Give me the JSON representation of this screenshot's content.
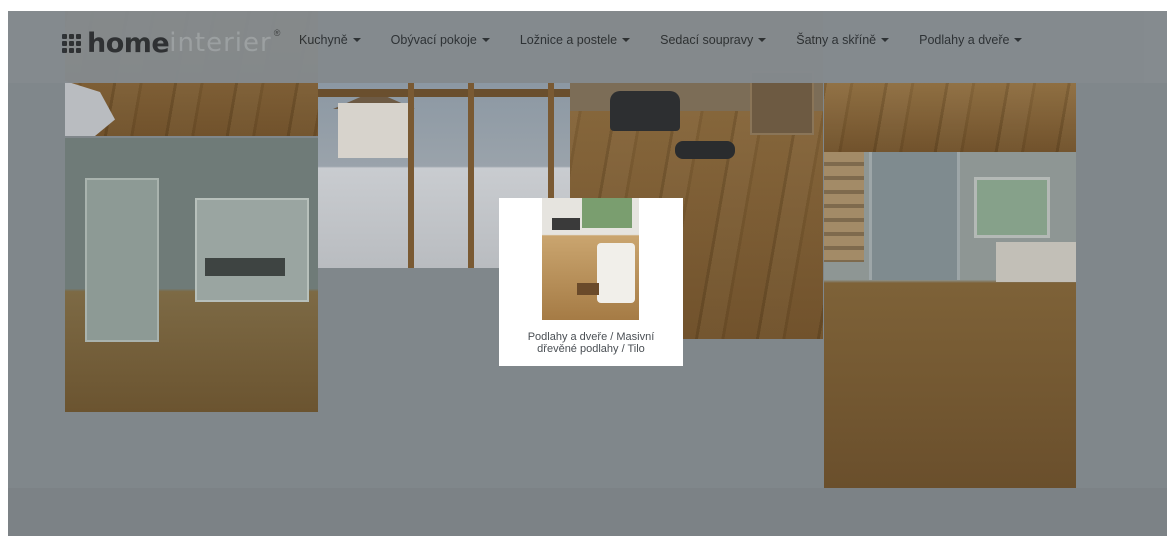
{
  "header": {
    "logo": {
      "word_bold": "home",
      "word_light": "interier",
      "reg_mark": "®"
    },
    "nav": [
      {
        "label": "Kuchyně"
      },
      {
        "label": "Obývací pokoje"
      },
      {
        "label": "Ložnice a postele"
      },
      {
        "label": "Sedací soupravy"
      },
      {
        "label": "Šatny a skříně"
      },
      {
        "label": "Podlahy a dveře"
      }
    ]
  },
  "popup": {
    "caption": "Podlahy a dveře / Masivní dřevěné podlahy / Tilo"
  },
  "colors": {
    "overlay": "#80878b",
    "header": "#858b8f",
    "logo_dark": "#2b2f33",
    "logo_light": "#9da3a7"
  }
}
